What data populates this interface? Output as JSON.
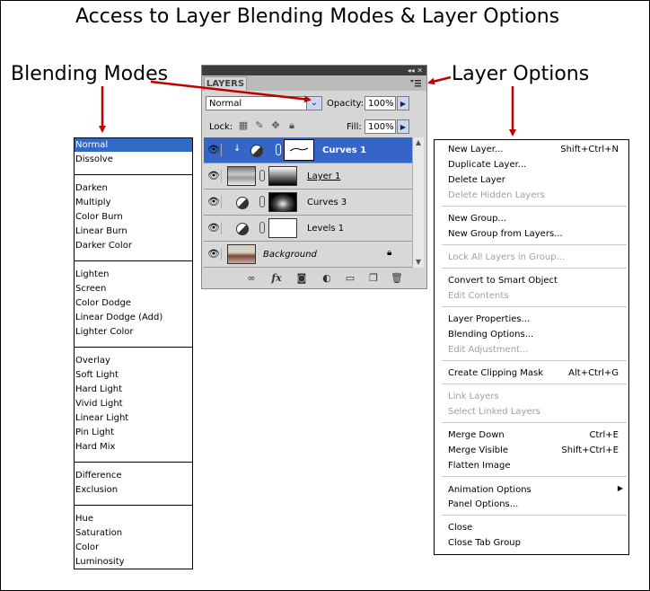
{
  "title": "Access to Layer Blending Modes & Layer Options",
  "callouts": {
    "blending": "Blending Modes",
    "options": "Layer Options"
  },
  "blend_modes": {
    "selected": "Normal",
    "items": [
      "Normal",
      "Dissolve",
      "Darken",
      "Multiply",
      "Color Burn",
      "Linear Burn",
      "Darker Color",
      "Lighten",
      "Screen",
      "Color Dodge",
      "Linear Dodge (Add)",
      "Lighter Color",
      "Overlay",
      "Soft Light",
      "Hard Light",
      "Vivid Light",
      "Linear Light",
      "Pin Light",
      "Hard Mix",
      "Difference",
      "Exclusion",
      "Hue",
      "Saturation",
      "Color",
      "Luminosity"
    ]
  },
  "panel": {
    "tab": "LAYERS",
    "collapse_glyph": "◂◂",
    "close_glyph": "✕",
    "mode": "Normal",
    "opacity_label": "Opacity:",
    "opacity_value": "100%",
    "lock_label": "Lock:",
    "fill_label": "Fill:",
    "fill_value": "100%",
    "layers": [
      {
        "name": "Curves 1",
        "selected": true
      },
      {
        "name": "Layer 1"
      },
      {
        "name": "Curves 3"
      },
      {
        "name": "Levels 1"
      },
      {
        "name": "Background",
        "locked": true
      }
    ],
    "footer_icons": [
      "link-icon",
      "fx-icon",
      "mask-icon",
      "adjustment-icon",
      "folder-icon",
      "new-layer-icon",
      "trash-icon"
    ],
    "fx_label": "fx"
  },
  "options_menu": {
    "items": [
      {
        "label": "New Layer...",
        "shortcut": "Shift+Ctrl+N"
      },
      {
        "label": "Duplicate Layer..."
      },
      {
        "label": "Delete Layer"
      },
      {
        "label": "Delete Hidden Layers",
        "disabled": true
      },
      {
        "label": "New Group..."
      },
      {
        "label": "New Group from Layers..."
      },
      {
        "label": "Lock All Layers in Group...",
        "disabled": true
      },
      {
        "label": "Convert to Smart Object"
      },
      {
        "label": "Edit Contents",
        "disabled": true
      },
      {
        "label": "Layer Properties..."
      },
      {
        "label": "Blending Options..."
      },
      {
        "label": "Edit Adjustment...",
        "disabled": true
      },
      {
        "label": "Create Clipping Mask",
        "shortcut": "Alt+Ctrl+G"
      },
      {
        "label": "Link Layers",
        "disabled": true
      },
      {
        "label": "Select Linked Layers",
        "disabled": true
      },
      {
        "label": "Merge Down",
        "shortcut": "Ctrl+E"
      },
      {
        "label": "Merge Visible",
        "shortcut": "Shift+Ctrl+E"
      },
      {
        "label": "Flatten Image"
      },
      {
        "label": "Animation Options"
      },
      {
        "label": "Panel Options..."
      },
      {
        "label": "Close"
      },
      {
        "label": "Close Tab Group"
      }
    ],
    "submenu_glyph": "▶"
  }
}
